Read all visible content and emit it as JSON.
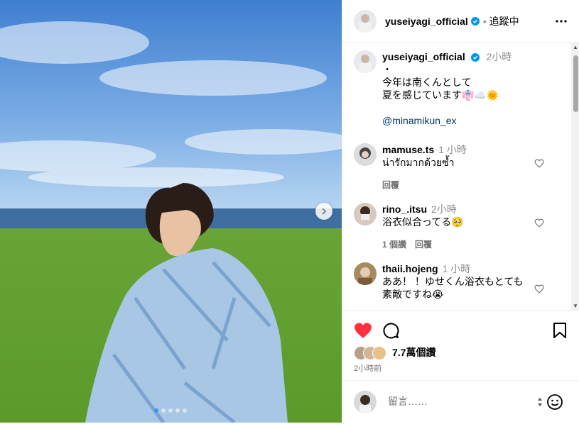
{
  "post": {
    "account": "yuseiyagi_official",
    "follow_state": "追蹤中",
    "dot_separator": "•",
    "caption_time": "2小時",
    "caption_lines": [
      "・",
      "今年は南くんとして",
      "夏を感じています"
    ],
    "caption_emojis": "👘☁️🌞",
    "mention": "@minamikun_ex",
    "likes": "7.7萬個讚",
    "posted": "2小時前",
    "comment_placeholder": "留言……"
  },
  "comments": [
    {
      "user": "mamuse.ts",
      "time": "1 小時",
      "text": "น่ารักมากด้วยซ้ำ",
      "reply": "回覆"
    },
    {
      "user": "rino_.itsu",
      "time": "2小時",
      "text": "浴衣似合ってる🥺",
      "likes": "1 個讚",
      "reply": "回覆"
    },
    {
      "user": "thaii.hojeng",
      "time": "1 小時",
      "text_line1": "ああ！ ！ゆせくん浴衣もとても",
      "text_line2": "素敵ですね😭"
    }
  ],
  "carousel": {
    "count": 5,
    "active": 0
  },
  "colors": {
    "accent": "#0095f6",
    "like_red": "#ff3040",
    "text_muted": "#737373"
  },
  "icons": [
    "more-icon",
    "verified-icon",
    "heart-icon",
    "comment-icon",
    "bookmark-icon",
    "emoji-icon",
    "next-arrow-icon"
  ]
}
